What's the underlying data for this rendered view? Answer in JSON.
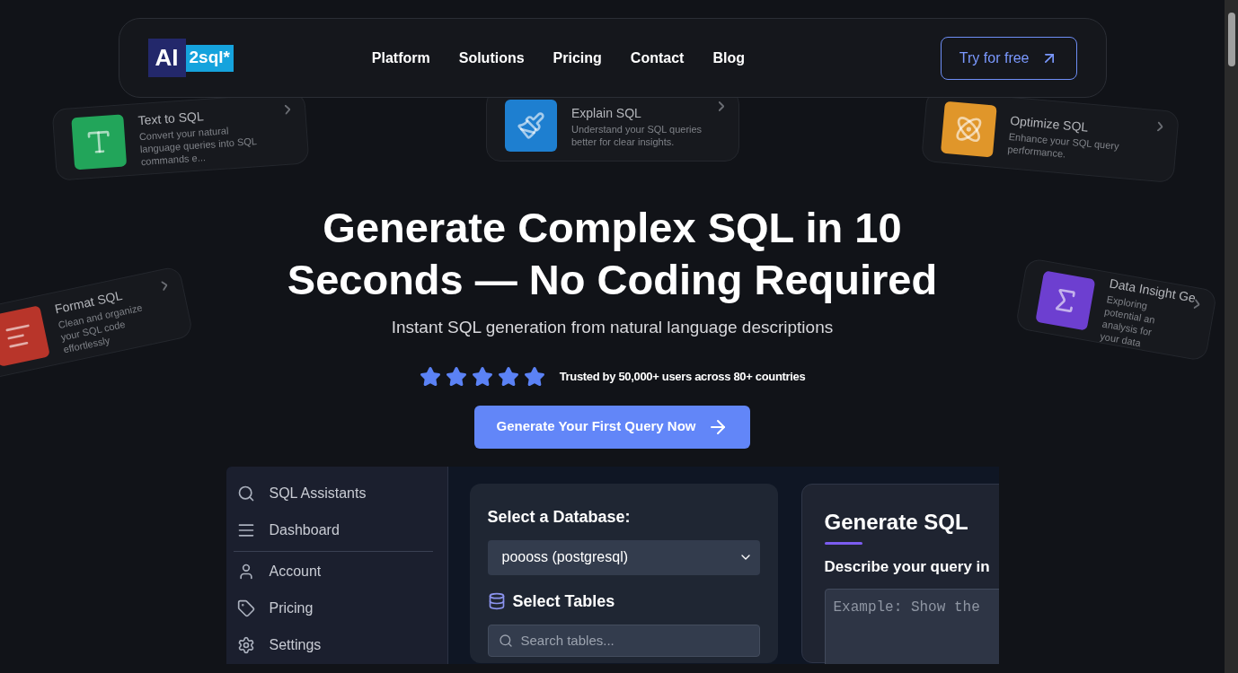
{
  "nav": {
    "logo": {
      "left": "AI",
      "right": "2sql*"
    },
    "links": [
      "Platform",
      "Solutions",
      "Pricing",
      "Contact",
      "Blog"
    ],
    "cta": "Try for free"
  },
  "feature_cards": [
    {
      "kind": "text",
      "title": "Text to SQL",
      "description": "Convert your natural language queries into SQL commands e...",
      "color": "#22a55a"
    },
    {
      "kind": "brush",
      "title": "Explain SQL",
      "description": "Understand your SQL queries better for clear insights.",
      "color": "#1e7fd0"
    },
    {
      "kind": "atom",
      "title": "Optimize SQL",
      "description": "Enhance your SQL query performance.",
      "color": "#e0962a"
    },
    {
      "kind": "format",
      "title": "Format SQL",
      "description": "Clean and organize your SQL code effortlessly",
      "color": "#b8352a"
    },
    {
      "kind": "sigma",
      "title": "Data Insight Ge",
      "description": "Exploring potential an analysis for your data",
      "color": "#6d3fd0"
    }
  ],
  "hero": {
    "title_lines": [
      "Generate Complex SQL in 10",
      "Seconds — No Coding Required"
    ],
    "subtitle": "Instant SQL generation from natural language descriptions",
    "stars": 5,
    "trust": "Trusted by 50,000+ users across 80+ countries",
    "button": "Generate Your First Query Now"
  },
  "app": {
    "sidebar": [
      {
        "kind": "search",
        "label": "SQL Assistants",
        "divider_after": false
      },
      {
        "kind": "dashboard",
        "label": "Dashboard",
        "divider_after": true
      },
      {
        "kind": "account",
        "label": "Account",
        "divider_after": false
      },
      {
        "kind": "pricing",
        "label": "Pricing",
        "divider_after": false
      },
      {
        "kind": "settings",
        "label": "Settings",
        "divider_after": false
      }
    ],
    "database_label": "Select a Database:",
    "database_value": "poooss (postgresql)",
    "tables_label": "Select Tables",
    "tables_search_placeholder": "Search tables...",
    "generate_title": "Generate SQL",
    "describe_label": "Describe your query in",
    "query_placeholder": "Example: Show the"
  }
}
